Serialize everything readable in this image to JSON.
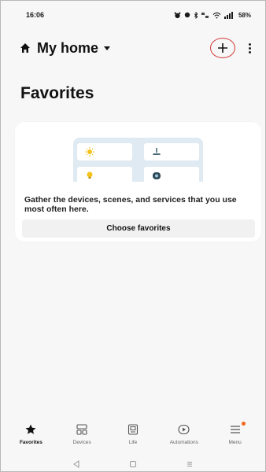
{
  "status_bar": {
    "time": "16:06",
    "right_text": "58%",
    "icons": [
      "alarm-icon",
      "record-icon",
      "bluetooth-icon",
      "data-speed-icon",
      "wifi-icon",
      "sim-signal-icon",
      "battery-icon"
    ]
  },
  "header": {
    "home_name": "My home",
    "icons": [
      "home-icon",
      "caret-down-icon",
      "plus-icon",
      "more-vert-icon"
    ]
  },
  "page": {
    "title": "Favorites"
  },
  "favorites_card": {
    "description": "Gather the devices, scenes, and services that you use most often here.",
    "button_label": "Choose favorites",
    "illustration_icons": [
      "sun-icon",
      "lamp-icon",
      "bulb-icon",
      "camera-icon"
    ]
  },
  "bottom_nav": {
    "items": [
      {
        "label": "Favorites",
        "icon": "star-icon",
        "active": true
      },
      {
        "label": "Devices",
        "icon": "devices-icon",
        "active": false
      },
      {
        "label": "Life",
        "icon": "life-icon",
        "active": false
      },
      {
        "label": "Automations",
        "icon": "automations-icon",
        "active": false
      },
      {
        "label": "Menu",
        "icon": "menu-icon",
        "active": false,
        "badge": true
      }
    ]
  },
  "system_nav": {
    "icons": [
      "back-icon",
      "home-nav-icon",
      "recents-icon"
    ]
  },
  "colors": {
    "background": "#f7f7f7",
    "card": "#ffffff",
    "illustration_bg": "#dfeaf2",
    "highlight_ring": "#d33a3a",
    "badge": "#f0661e"
  }
}
